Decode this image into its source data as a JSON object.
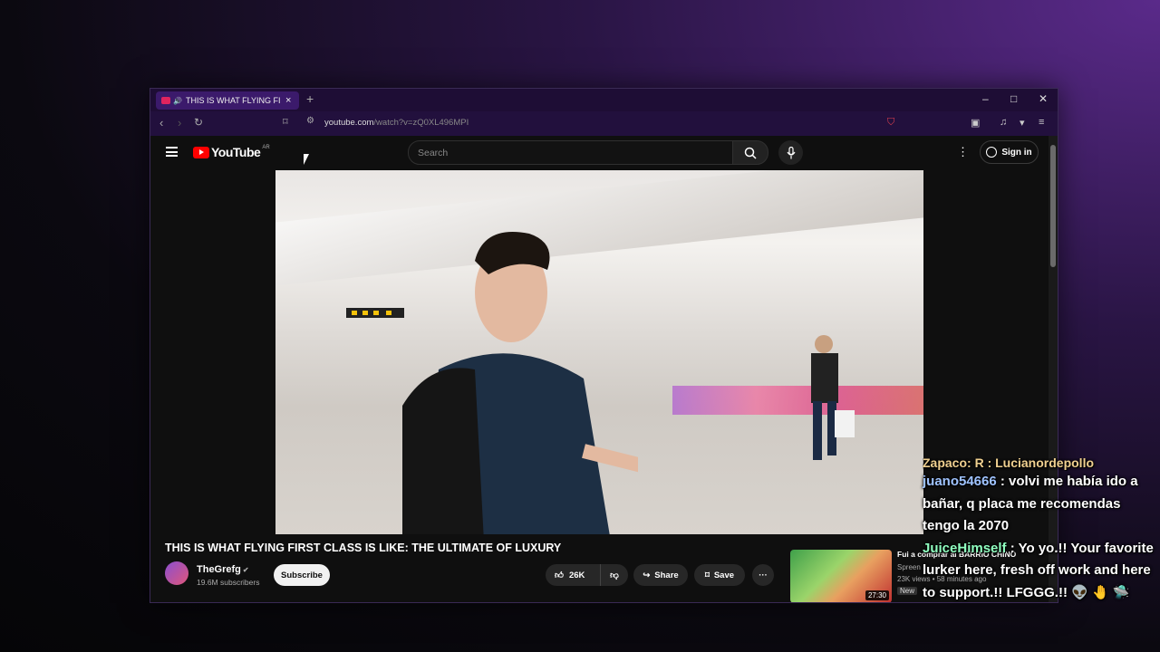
{
  "browser": {
    "tab_title": "THIS IS WHAT FLYING FIRST C",
    "new_tab": "+",
    "url_main": "youtube.com",
    "url_path": "/watch?v=zQ0XL496MPI",
    "minimize": "–",
    "maximize": "□",
    "close": "✕"
  },
  "youtube": {
    "logo_text": "YouTube",
    "country_code": "AR",
    "search_placeholder": "Search",
    "sign_in": "Sign in"
  },
  "video": {
    "title": "THIS IS WHAT FLYING FIRST CLASS IS LIKE: THE ULTIMATE OF LUXURY",
    "channel": "TheGrefg",
    "subscribers": "19.6M subscribers",
    "subscribe_label": "Subscribe",
    "likes": "26K",
    "share_label": "Share",
    "save_label": "Save",
    "more": "···"
  },
  "recommendation": {
    "title": "Fui a comprar al BARRIO CHINO",
    "channel": "Spreen",
    "views": "23K views",
    "age": "58 minutes ago",
    "badge": "New",
    "duration": "27:30"
  },
  "chat": {
    "cut_line": "Zapaco: R : Lucianordepollo",
    "messages": [
      {
        "user": "juano54666",
        "text": ": volvi me había ido a bañar, q placa me recomendas tengo la 2070"
      },
      {
        "user": "JuiceHimself",
        "text": ": Yo yo.!! Your favorite lurker here, fresh off work and here to support.!! LFGGG.!! 👽 🤚 🛸"
      }
    ]
  },
  "colors": {
    "accent": "#3b1a6b",
    "youtube_red": "#ff0000",
    "user1": "#9fc3ff",
    "user2": "#90ffc0"
  }
}
